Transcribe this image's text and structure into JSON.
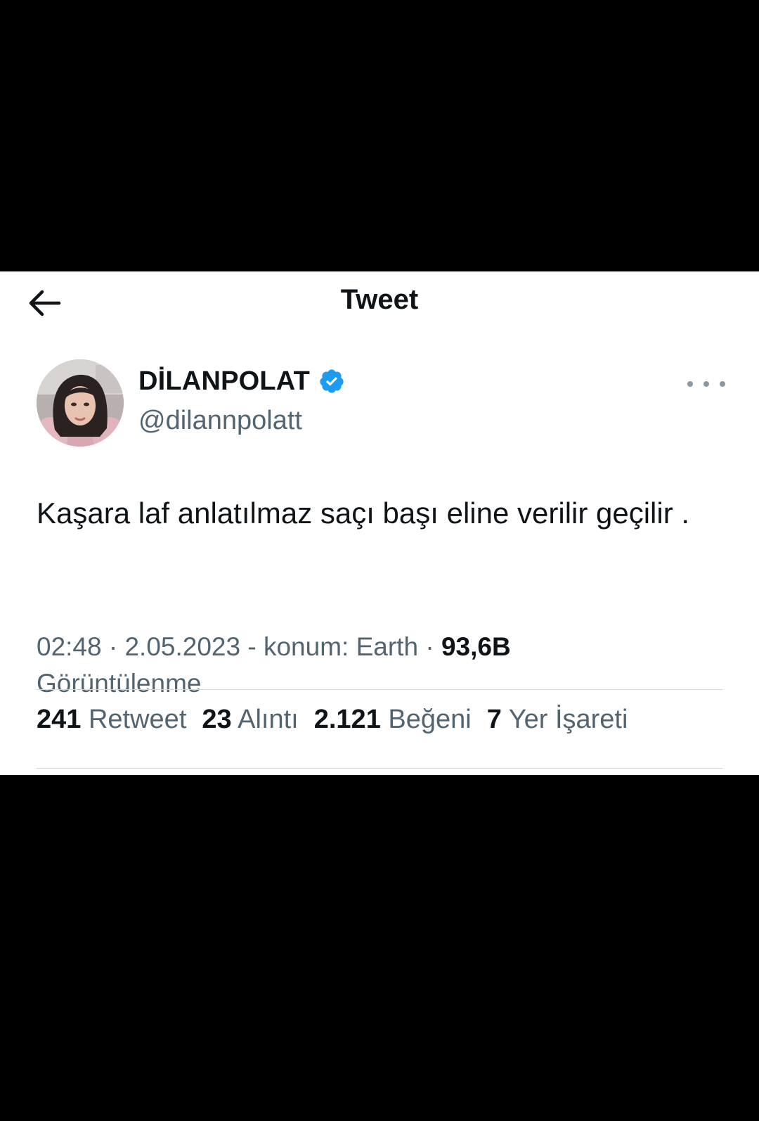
{
  "header": {
    "title": "Tweet",
    "back_icon": "arrow-left-icon"
  },
  "author": {
    "display_name": "DİLANPOLAT",
    "handle": "@dilannpolatt",
    "verified_icon": "verified-badge-icon",
    "verified_color": "#1d9bf0"
  },
  "tweet": {
    "text": "Kaşara laf anlatılmaz saçı başı eline verilir geçilir ."
  },
  "meta": {
    "time": "02:48",
    "sep1": " · ",
    "date": "2.05.2023",
    "sep2": " - ",
    "location": "konum: Earth",
    "sep3": " · ",
    "views_count": "93,6B",
    "views_label": "Görüntülenme"
  },
  "stats": [
    {
      "count": "241",
      "label": "Retweet"
    },
    {
      "count": "23",
      "label": "Alıntı"
    },
    {
      "count": "2.121",
      "label": "Beğeni"
    },
    {
      "count": "7",
      "label": "Yer İşareti"
    }
  ],
  "colors": {
    "text_primary": "#0f1419",
    "text_secondary": "#536471",
    "divider": "#cfd9de",
    "background_outer": "#000000",
    "background_panel": "#ffffff"
  }
}
